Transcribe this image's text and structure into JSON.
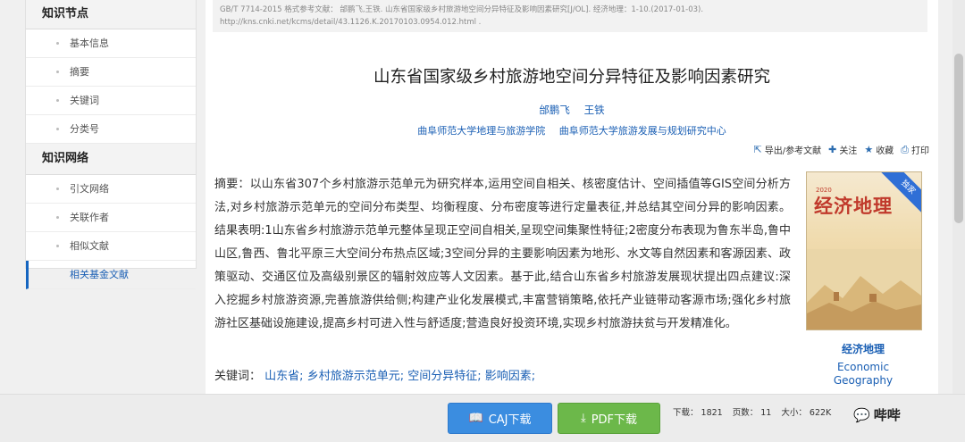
{
  "sidebar": {
    "section1_title": "知识节点",
    "section1_items": [
      "基本信息",
      "摘要",
      "关键词",
      "分类号"
    ],
    "section2_title": "知识网络",
    "section2_items": [
      "引文网络",
      "关联作者",
      "相似文献",
      "相关基金文献"
    ]
  },
  "citation": "GB/T 7714-2015 格式参考文献：  邰鹏飞,王铁. 山东省国家级乡村旅游地空间分异特征及影响因素研究[J/OL]. 经济地理：1-10.(2017-01-03). http://kns.cnki.net/kcms/detail/43.1126.K.20170103.0954.012.html .",
  "article": {
    "title": "山东省国家级乡村旅游地空间分异特征及影响因素研究",
    "authors": [
      "邰鹏飞",
      "王铁"
    ],
    "orgs": [
      "曲阜师范大学地理与旅游学院",
      "曲阜师范大学旅游发展与规划研究中心"
    ],
    "abstract": "摘要：以山东省307个乡村旅游示范单元为研究样本,运用空间自相关、核密度估计、空间插值等GIS空间分析方法,对乡村旅游示范单元的空间分布类型、均衡程度、分布密度等进行定量表征,并总结其空间分异的影响因素。结果表明:1山东省乡村旅游示范单元整体呈现正空间自相关,呈现空间集聚性特征;2密度分布表现为鲁东半岛,鲁中山区,鲁西、鲁北平原三大空间分布热点区域;3空间分异的主要影响因素为地形、水文等自然因素和客源因素、政策驱动、交通区位及高级别景区的辐射效应等人文因素。基于此,结合山东省乡村旅游发展现状提出四点建议:深入挖掘乡村旅游资源,完善旅游供给侧;构建产业化发展模式,丰富营销策略,依托产业链带动客源市场;强化乡村旅游社区基础设施建设,提高乡村可进入性与舒适度;营造良好投资环境,实现乡村旅游扶贫与开发精准化。",
    "keywords_label": "关键词：",
    "keywords": [
      "山东省;",
      "乡村旅游示范单元;",
      "空间分异特征;",
      "影响因素;"
    ]
  },
  "toolbar": {
    "export": "导出/参考文献",
    "follow": "关注",
    "favorite": "收藏",
    "print": "打印"
  },
  "journal": {
    "name_cn": "经济地理",
    "name_en_1": "Economic",
    "name_en_2": "Geography",
    "cover_title": "经济地理",
    "cover_year": "2020",
    "cover_badge": "独家"
  },
  "download": {
    "caj_label": "CAJ下载",
    "pdf_label": "PDF下载",
    "downloads": "下载：  1821",
    "pages": "页数：  11",
    "size": "大小：  622K"
  },
  "watermark": "哔哔"
}
